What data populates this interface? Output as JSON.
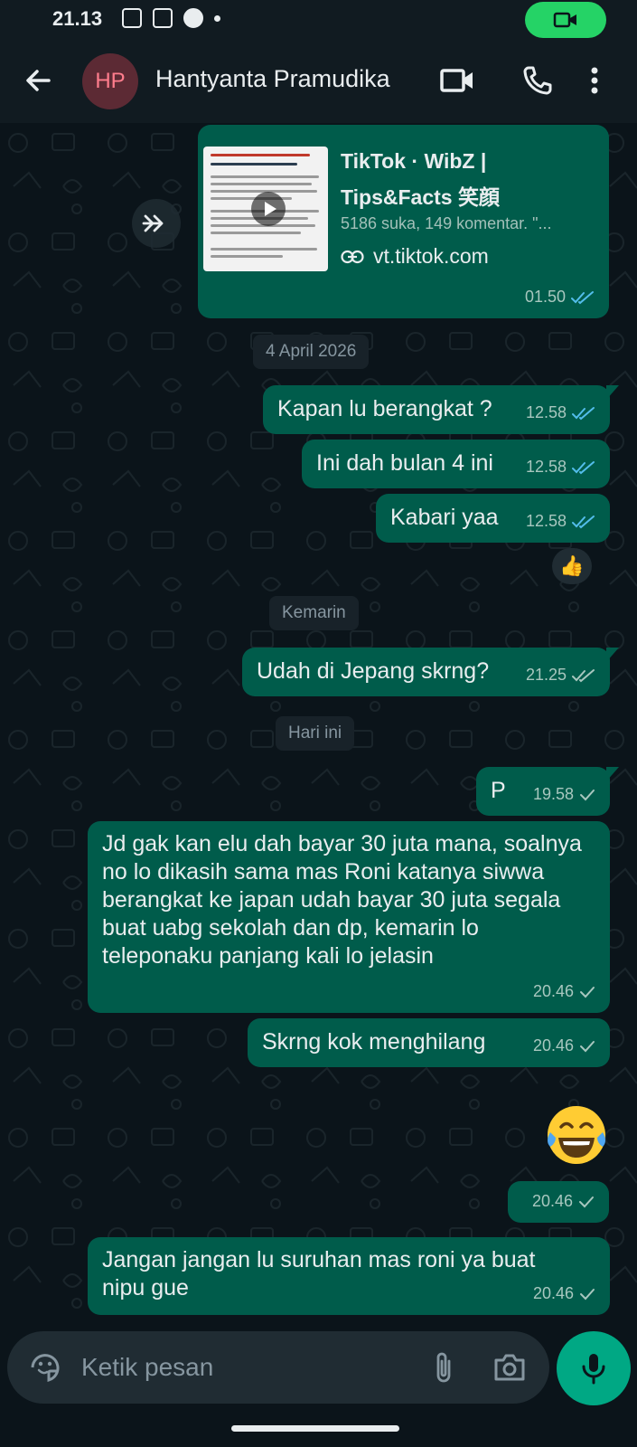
{
  "status_bar": {
    "time": "21.13"
  },
  "header": {
    "avatar_initials": "HP",
    "contact_name": "Hantyanta Pramudika"
  },
  "link_preview": {
    "title": "TikTok · WibZ | Tips&Facts 笑顔",
    "description": "5186 suka, 149 komentar. \"...",
    "domain": "vt.tiktok.com",
    "time": "01.50"
  },
  "date_chips": [
    "4 April 2026",
    "Kemarin",
    "Hari ini"
  ],
  "messages": [
    {
      "text": "Kapan lu berangkat ?",
      "time": "12.58",
      "status": "read"
    },
    {
      "text": "Ini dah bulan 4 ini",
      "time": "12.58",
      "status": "read"
    },
    {
      "text": "Kabari yaa",
      "time": "12.58",
      "status": "read"
    },
    {
      "text": "Udah di Jepang skrng?",
      "time": "21.25",
      "status": "delivered"
    },
    {
      "text": "P",
      "time": "19.58",
      "status": "sent"
    },
    {
      "text": "Jd gak kan elu dah bayar 30 juta mana, soalnya no lo dikasih sama mas Roni katanya siwwa berangkat ke japan udah bayar 30 juta segala buat uabg sekolah dan dp, kemarin lo teleponaku panjang kali lo jelasin",
      "time": "20.46",
      "status": "sent"
    },
    {
      "text": "Skrng kok menghilang",
      "time": "20.46",
      "status": "sent"
    },
    {
      "text": "",
      "time": "20.46",
      "status": "sent"
    },
    {
      "text": "Jangan jangan lu suruhan mas roni ya buat nipu gue",
      "time": "20.46",
      "status": "sent"
    }
  ],
  "reaction": "👍",
  "sticker_emoji": "😂",
  "composer": {
    "placeholder": "Ketik pesan"
  },
  "colors": {
    "outgoing_bubble": "#005c4b",
    "accent": "#00a884",
    "read_tick": "#53bdeb",
    "background": "#0b141a"
  }
}
